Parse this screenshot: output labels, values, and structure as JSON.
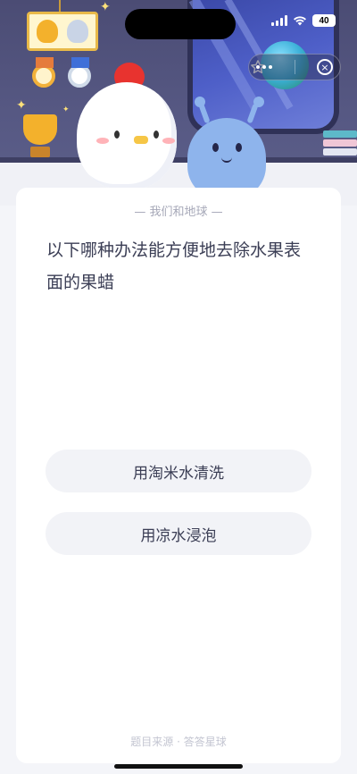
{
  "status_bar": {
    "battery": "40"
  },
  "card": {
    "header": "— 我们和地球 —",
    "question": "以下哪种办法能方便地去除水果表面的果蜡",
    "options": [
      {
        "label": "用淘米水清洗"
      },
      {
        "label": "用凉水浸泡"
      }
    ],
    "footer": "题目来源 · 答答星球"
  },
  "capsule": {
    "icons": [
      "star-icon",
      "more-icon",
      "close-icon"
    ]
  },
  "colors": {
    "hero_bg": "#4b4c74",
    "card_bg": "#ffffff",
    "option_bg": "#f2f3f7",
    "text": "#3b3e55",
    "muted": "#a6a8b8"
  }
}
